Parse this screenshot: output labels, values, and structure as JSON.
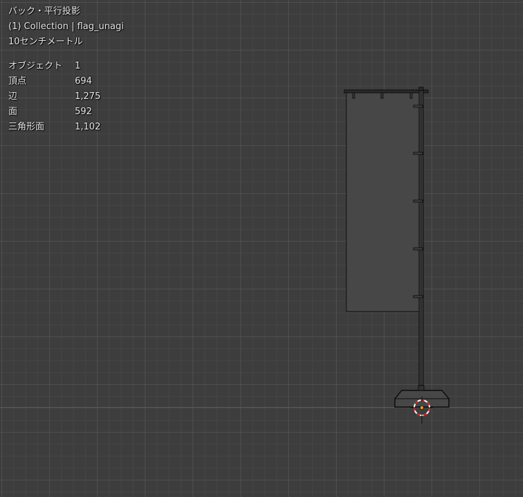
{
  "viewport": {
    "view_name": "バック・平行投影",
    "collection": "(1) Collection | flag_unagi",
    "grid_scale": "10センチメートル"
  },
  "stats": [
    {
      "label": "オブジェクト",
      "value": "1"
    },
    {
      "label": "頂点",
      "value": "694"
    },
    {
      "label": "辺",
      "value": "1,275"
    },
    {
      "label": "面",
      "value": "592"
    },
    {
      "label": "三角形面",
      "value": "1,102"
    }
  ],
  "colors": {
    "background": "#3d3d3d",
    "grid": "#505050",
    "x_axis": "#a33a46",
    "mesh_fill": "#474747",
    "mesh_edge": "#101010",
    "origin": "#f0a020",
    "cursor_red": "#d02020"
  },
  "icons": {
    "cursor": "3d-cursor-icon",
    "origin": "object-origin-icon"
  }
}
